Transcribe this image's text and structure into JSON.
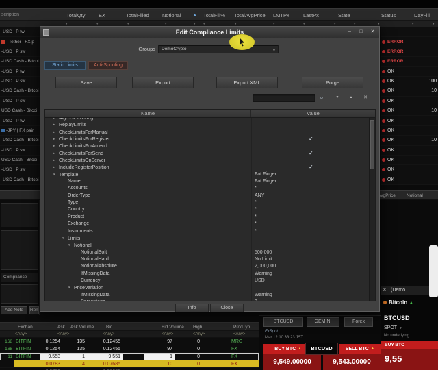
{
  "window": {
    "top_menu_fragment": "scription"
  },
  "top_grid": {
    "columns": [
      "TotalQty",
      "EX",
      "TotalFilled",
      "Notional",
      "TotalFill%",
      "TotalAvgPrice",
      "LMTPx",
      "LastPx",
      "State",
      "Status",
      "DayFill"
    ],
    "left_rows": [
      {
        "text": "-USD | P tw",
        "icon": null
      },
      {
        "text": "- Tether | FX p",
        "icon": "red"
      },
      {
        "text": "-USD | P sw",
        "icon": null
      },
      {
        "text": "-USD Cash - Bitcoi",
        "icon": null
      },
      {
        "text": "-USD | P tw",
        "icon": null
      },
      {
        "text": "-USD | P sw",
        "icon": null
      },
      {
        "text": "-USD Cash - Bitcoi",
        "icon": null
      },
      {
        "text": "-USD | P sw",
        "icon": null
      },
      {
        "text": "USD Cash - Bitcoi",
        "icon": null
      },
      {
        "text": "-USD | P tw",
        "icon": null
      },
      {
        "text": "-JPY | FX pair",
        "icon": "blue"
      },
      {
        "text": "-USD Cash - Bitcoi",
        "icon": null
      },
      {
        "text": "-USD | P sw",
        "icon": null
      },
      {
        "text": "USD Cash - Bitcoi",
        "icon": null
      },
      {
        "text": "-USD | P sw",
        "icon": null
      },
      {
        "text": "-USD Cash - Bitcoi",
        "icon": null
      }
    ],
    "right_rows": [
      {
        "status": "",
        "value": ""
      },
      {
        "status": "ERROR",
        "value": ""
      },
      {
        "status": "ERROR",
        "value": ""
      },
      {
        "status": "ERROR",
        "value": ""
      },
      {
        "status": "OK",
        "value": ""
      },
      {
        "status": "OK",
        "value": "100"
      },
      {
        "status": "OK",
        "value": "10"
      },
      {
        "status": "OK",
        "value": ""
      },
      {
        "status": "OK",
        "value": "10"
      },
      {
        "status": "OK",
        "value": ""
      },
      {
        "status": "OK",
        "value": ""
      },
      {
        "status": "OK",
        "value": "10"
      },
      {
        "status": "OK",
        "value": ""
      },
      {
        "status": "OK",
        "value": ""
      },
      {
        "status": "OK",
        "value": ""
      },
      {
        "status": "OK",
        "value": ""
      }
    ]
  },
  "mid_headers": {
    "avg_price": "AvgPrice",
    "notional": "Notional"
  },
  "left_panel": {
    "compliance": "Compliance",
    "add_note": "Add Note",
    "remove": "Rem"
  },
  "dialog": {
    "title": "Edit Compliance Limits",
    "groups_label": "Groups",
    "groups_value": "DemoCrypto",
    "tabs": [
      {
        "label": "Static Limits",
        "active": true
      },
      {
        "label": "Anti-Spoofing",
        "active": false
      }
    ],
    "buttons": [
      "Save",
      "Export",
      "Export XML",
      "Purge"
    ],
    "table": {
      "name_header": "Name",
      "value_header": "Value",
      "rows": [
        {
          "name": "Algos & Routing",
          "indent": 0,
          "arrow": "right",
          "value": "",
          "check": false
        },
        {
          "name": "ReplayLimits",
          "indent": 0,
          "arrow": "right",
          "value": "",
          "check": false
        },
        {
          "name": "CheckLimitsForManual",
          "indent": 0,
          "arrow": "right",
          "value": "",
          "check": false
        },
        {
          "name": "CheckLimitsForRegister",
          "indent": 0,
          "arrow": "right",
          "value": "",
          "check": true
        },
        {
          "name": "CheckLimitsForAmend",
          "indent": 0,
          "arrow": "right",
          "value": "",
          "check": false
        },
        {
          "name": "CheckLimitsForSend",
          "indent": 0,
          "arrow": "right",
          "value": "",
          "check": true
        },
        {
          "name": "CheckLimitsOnServer",
          "indent": 0,
          "arrow": "right",
          "value": "",
          "check": false
        },
        {
          "name": "IncludeRegisterPosition",
          "indent": 0,
          "arrow": "right",
          "value": "",
          "check": true
        },
        {
          "name": "Template",
          "indent": 0,
          "arrow": "down",
          "value": "Fat Finger",
          "check": false
        },
        {
          "name": "Name",
          "indent": 1,
          "arrow": null,
          "value": "Fat Finger",
          "check": false
        },
        {
          "name": "Accounts",
          "indent": 1,
          "arrow": null,
          "value": "*",
          "check": false
        },
        {
          "name": "OrderType",
          "indent": 1,
          "arrow": null,
          "value": "ANY",
          "check": false
        },
        {
          "name": "Type",
          "indent": 1,
          "arrow": null,
          "value": "*",
          "check": false
        },
        {
          "name": "Country",
          "indent": 1,
          "arrow": null,
          "value": "*",
          "check": false
        },
        {
          "name": "Product",
          "indent": 1,
          "arrow": null,
          "value": "*",
          "check": false
        },
        {
          "name": "Exchange",
          "indent": 1,
          "arrow": null,
          "value": "*",
          "check": false
        },
        {
          "name": "Instruments",
          "indent": 1,
          "arrow": null,
          "value": "*",
          "check": false
        },
        {
          "name": "Limits",
          "indent": 1,
          "arrow": "down",
          "value": "",
          "check": false
        },
        {
          "name": "Notional",
          "indent": 2,
          "arrow": "down",
          "value": "",
          "check": false
        },
        {
          "name": "NotionalSoft",
          "indent": 3,
          "arrow": null,
          "value": "500,000",
          "check": false
        },
        {
          "name": "NotionalHard",
          "indent": 3,
          "arrow": null,
          "value": "No Limit",
          "check": false
        },
        {
          "name": "NotionalAbsolute",
          "indent": 3,
          "arrow": null,
          "value": "2,000,000",
          "check": false
        },
        {
          "name": "IfMissingData",
          "indent": 3,
          "arrow": null,
          "value": "Warning",
          "check": false
        },
        {
          "name": "Currency",
          "indent": 3,
          "arrow": null,
          "value": "USD",
          "check": false
        },
        {
          "name": "PriceVariation",
          "indent": 2,
          "arrow": "down",
          "value": "",
          "check": false
        },
        {
          "name": "IfMissingData",
          "indent": 3,
          "arrow": null,
          "value": "Warning",
          "check": false
        },
        {
          "name": "Percentage",
          "indent": 3,
          "arrow": null,
          "value": "2",
          "check": false
        }
      ]
    },
    "footer": {
      "info": "Info",
      "close": "Close"
    }
  },
  "market": {
    "headers": [
      "Exchan...",
      "Ask",
      "Ask Volume",
      "Bid",
      "Bid Volume",
      "High",
      "ProdTyp..."
    ],
    "filter": "<Any>",
    "rows": [
      {
        "num": "168",
        "exchange": "BITFIN",
        "ask": "0.1254",
        "ask_volume": "135",
        "bid": "0.12455",
        "bid_volume": "97",
        "high": "0",
        "prod_type": "MRG",
        "style": "normal"
      },
      {
        "num": "168",
        "exchange": "BITFIN",
        "ask": "0.1254",
        "ask_volume": "135",
        "bid": "0.12455",
        "bid_volume": "97",
        "high": "0",
        "prod_type": "FX",
        "style": "normal"
      },
      {
        "num": "11",
        "exchange": "BITFIN",
        "ask": "9,553",
        "ask_volume": "1",
        "bid": "9,551",
        "bid_volume": "1",
        "high": "0",
        "prod_type": "FX",
        "style": "sel"
      },
      {
        "num": "",
        "exchange": "",
        "ask": "0.0783",
        "ask_volume": "4",
        "bid": "0.07685",
        "bid_volume": "10",
        "high": "0",
        "prod_type": "FX",
        "style": "warn"
      },
      {
        "num": "",
        "exchange": "",
        "ask": "0.0783",
        "ask_volume": "",
        "bid": "0.07685",
        "bid_volume": "",
        "high": "",
        "prod_type": "",
        "style": "dim"
      }
    ]
  },
  "ticket": {
    "tabs": [
      "BTCUSD",
      "GEMINI",
      "Forex"
    ],
    "subtext": "FxSpot",
    "timestamp": "Mar 12 10:33:23 JST",
    "buy_label": "BUY BTC",
    "sell_label": "SELL BTC",
    "symbol": "BTCUSD",
    "buy_price": "9,549.00000",
    "sell_price": "9,543.00000"
  },
  "side_panel": {
    "window_title": "(Demo",
    "instrument": "Bitcoin",
    "symbol": "BTCUSD",
    "type": "SPOT",
    "underlying": "No underlying",
    "buy_label": "BUY BTC",
    "price_fragment": "9,55"
  },
  "colors": {
    "error_red": "#e04545",
    "warning_yellow": "#d9bb22",
    "buy_sell_red": "#c21d1d",
    "price_panel_red": "#8a1414",
    "tab_blue": "#79afe0",
    "tab_red": "#ce6c57",
    "exchange_green": "#58b758",
    "cursor_highlight": "#e6db3e"
  }
}
